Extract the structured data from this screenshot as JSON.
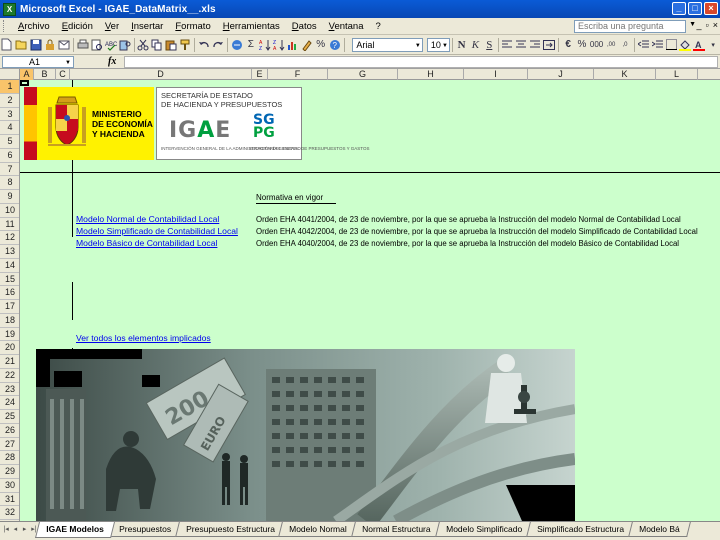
{
  "window": {
    "title": "Microsoft Excel - IGAE_DataMatrix__.xls",
    "app_icon_letter": "X",
    "minimize": "_",
    "maximize": "□",
    "close": "×"
  },
  "menu": {
    "items": [
      "Archivo",
      "Edición",
      "Ver",
      "Insertar",
      "Formato",
      "Herramientas",
      "Datos",
      "Ventana",
      "?"
    ],
    "ask_placeholder": "Escriba una pregunta",
    "doc_minimize": "_",
    "doc_restore": "▫",
    "doc_close": "×"
  },
  "toolbar": {
    "font_name": "Arial",
    "font_size": "10",
    "sum_symbol": "Σ",
    "zoom_symbol": "%"
  },
  "formula_bar": {
    "cell_ref": "A1",
    "fx": "fx",
    "content": ""
  },
  "columns": [
    "A",
    "B",
    "C",
    "D",
    "E",
    "F",
    "G",
    "H",
    "I",
    "J",
    "K",
    "L"
  ],
  "rows": [
    "1",
    "2",
    "3",
    "4",
    "5",
    "6",
    "7",
    "8",
    "9",
    "10",
    "11",
    "12",
    "13",
    "14",
    "15",
    "16",
    "17",
    "18",
    "19",
    "20",
    "21",
    "22",
    "23",
    "24",
    "25",
    "26",
    "27",
    "28",
    "29",
    "30",
    "31",
    "32"
  ],
  "selected_column": "A",
  "selected_row": "1",
  "logos": {
    "ministerio": "MINISTERIO\nDE ECONOMÍA\nY HACIENDA",
    "secretaria": "SECRETARÍA DE ESTADO\nDE HACIENDA Y PRESUPUESTOS",
    "igae_prefix": "IG",
    "igae_accent": "A",
    "igae_suffix": "E",
    "igae_sub": "INTERVENCIÓN GENERAL DE LA ADMINISTRACIÓN DEL ESTADO",
    "sgpg_top": "SG",
    "sgpg_bottom": "PG",
    "sgpg_sub": "SECRETARÍA GENERAL DE PRESUPUESTOS Y GASTOS"
  },
  "content": {
    "normativa_heading": "Normativa en vigor",
    "links": [
      "Modelo Normal de Contabilidad Local",
      "Modelo Simplificado de Contabilidad Local",
      "Modelo Básico de Contabilidad Local"
    ],
    "orders": [
      "Orden EHA 4041/2004, de 23 de noviembre, por la que se aprueba la Instrucción del modelo Normal de Contabilidad Local",
      "Orden EHA 4042/2004, de 23 de noviembre, por la que se aprueba la Instrucción del modelo Simplificado de Contabilidad Local",
      "Orden EHA 4040/2004, de 23 de noviembre, por la que se aprueba la Instrucción del modelo Básico de Contabilidad Local"
    ],
    "all_elements_link": "Ver todos los elementos implicados"
  },
  "sheet_tabs": {
    "tabs": [
      "IGAE Modelos",
      "Presupuestos",
      "Presupuesto Estructura",
      "Modelo Normal",
      "Normal Estructura",
      "Modelo Simplificado",
      "Simplificado Estructura",
      "Modelo Bá"
    ],
    "active_index": 0,
    "nav": [
      "|◂",
      "◂",
      "▸",
      "▸|"
    ]
  },
  "colors": {
    "grid_background": "#ccffcc",
    "title_bar": "#0a5bd6",
    "link": "#0000ee",
    "selected_header": "#f9c46a"
  }
}
